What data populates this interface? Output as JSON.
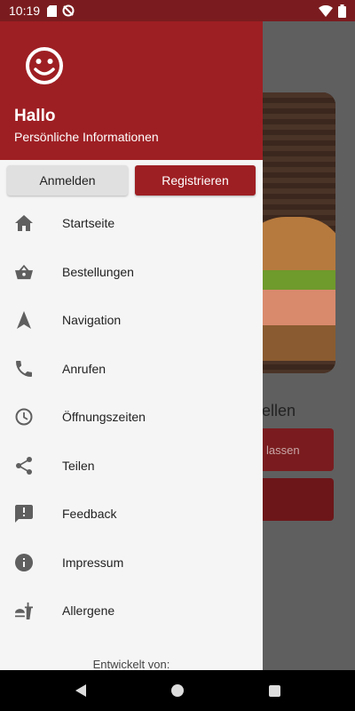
{
  "status_bar": {
    "time": "10:19",
    "left_icons": [
      "sd-card-icon",
      "sync-disabled-icon"
    ],
    "right_icons": [
      "wifi-icon",
      "battery-icon"
    ]
  },
  "drawer": {
    "header": {
      "greeting": "Hallo",
      "subtitle": "Persönliche Informationen",
      "avatar_icon": "smiley-icon",
      "color": "#9e1f23"
    },
    "auth": {
      "login_label": "Anmelden",
      "register_label": "Registrieren"
    },
    "menu": [
      {
        "label": "Startseite",
        "icon": "home-icon"
      },
      {
        "label": "Bestellungen",
        "icon": "basket-icon"
      },
      {
        "label": "Navigation",
        "icon": "navigation-icon"
      },
      {
        "label": "Anrufen",
        "icon": "phone-icon"
      },
      {
        "label": "Öffnungszeiten",
        "icon": "clock-icon"
      },
      {
        "label": "Teilen",
        "icon": "share-icon"
      },
      {
        "label": "Feedback",
        "icon": "feedback-icon"
      },
      {
        "label": "Impressum",
        "icon": "info-icon"
      },
      {
        "label": "Allergene",
        "icon": "fastfood-icon"
      }
    ],
    "footer_text": "Entwickelt von:"
  },
  "background": {
    "heading_fragment": "tellen",
    "button_fragment": "lassen"
  }
}
